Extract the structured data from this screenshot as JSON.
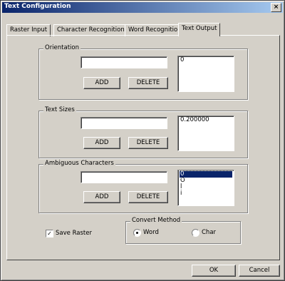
{
  "window": {
    "title": "Text Configuration",
    "close_glyph": "×"
  },
  "tabs": [
    {
      "label": "Raster Input"
    },
    {
      "label": "Character Recognition"
    },
    {
      "label": "Word Recognition"
    },
    {
      "label": "Text Output",
      "active": true
    }
  ],
  "orientation": {
    "title": "Orientation",
    "input_value": "",
    "add_label": "ADD",
    "delete_label": "DELETE",
    "items": [
      "0"
    ]
  },
  "text_sizes": {
    "title": "Text Sizes",
    "input_value": "",
    "add_label": "ADD",
    "delete_label": "DELETE",
    "items": [
      "0.200000"
    ]
  },
  "ambiguous": {
    "title": "Ambiguous Characters",
    "input_value": "",
    "add_label": "ADD",
    "delete_label": "DELETE",
    "items": [
      "0",
      "O",
      "l",
      "i"
    ]
  },
  "save_raster": {
    "label": "Save Raster",
    "checked": true,
    "check_glyph": "✓"
  },
  "convert_method": {
    "title": "Convert Method",
    "options": [
      {
        "label": "Word",
        "checked": true
      },
      {
        "label": "Char",
        "checked": false
      }
    ]
  },
  "footer": {
    "ok_label": "OK",
    "cancel_label": "Cancel"
  },
  "colors": {
    "face": "#d4d0c8",
    "title_start": "#0a246a",
    "title_end": "#a6caf0",
    "selection": "#0a246a"
  }
}
